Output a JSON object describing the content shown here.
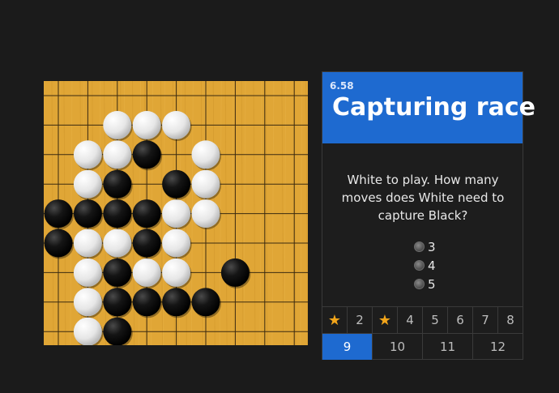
{
  "lesson": {
    "number": "6.58",
    "title": "Capturing race"
  },
  "question": "White to play. How many moves does White need to capture Black?",
  "options": [
    "3",
    "4",
    "5"
  ],
  "nav_row1": [
    {
      "label": "",
      "icon": "star-icon",
      "completed": true
    },
    {
      "label": "2",
      "completed": false
    },
    {
      "label": "",
      "icon": "star-icon",
      "completed": true
    },
    {
      "label": "4",
      "completed": false
    },
    {
      "label": "5",
      "completed": false
    },
    {
      "label": "6",
      "completed": false
    },
    {
      "label": "7",
      "completed": false
    },
    {
      "label": "8",
      "completed": false
    }
  ],
  "nav_row2": [
    {
      "label": "9",
      "active": true
    },
    {
      "label": "10",
      "active": false
    },
    {
      "label": "11",
      "active": false
    },
    {
      "label": "12",
      "active": false
    }
  ],
  "board": {
    "size_visible": 9,
    "board_color": "#e0a636",
    "white_stones": [
      [
        2,
        1
      ],
      [
        3,
        1
      ],
      [
        4,
        1
      ],
      [
        1,
        2
      ],
      [
        2,
        2
      ],
      [
        5,
        2
      ],
      [
        1,
        3
      ],
      [
        5,
        3
      ],
      [
        4,
        4
      ],
      [
        5,
        4
      ],
      [
        1,
        5
      ],
      [
        2,
        5
      ],
      [
        4,
        5
      ],
      [
        1,
        6
      ],
      [
        3,
        6
      ],
      [
        4,
        6
      ],
      [
        1,
        7
      ],
      [
        1,
        8
      ]
    ],
    "black_stones": [
      [
        3,
        2
      ],
      [
        2,
        3
      ],
      [
        4,
        3
      ],
      [
        0,
        4
      ],
      [
        1,
        4
      ],
      [
        2,
        4
      ],
      [
        3,
        4
      ],
      [
        0,
        5
      ],
      [
        3,
        5
      ],
      [
        2,
        6
      ],
      [
        6,
        6
      ],
      [
        2,
        7
      ],
      [
        3,
        7
      ],
      [
        4,
        7
      ],
      [
        5,
        7
      ],
      [
        2,
        8
      ]
    ]
  }
}
